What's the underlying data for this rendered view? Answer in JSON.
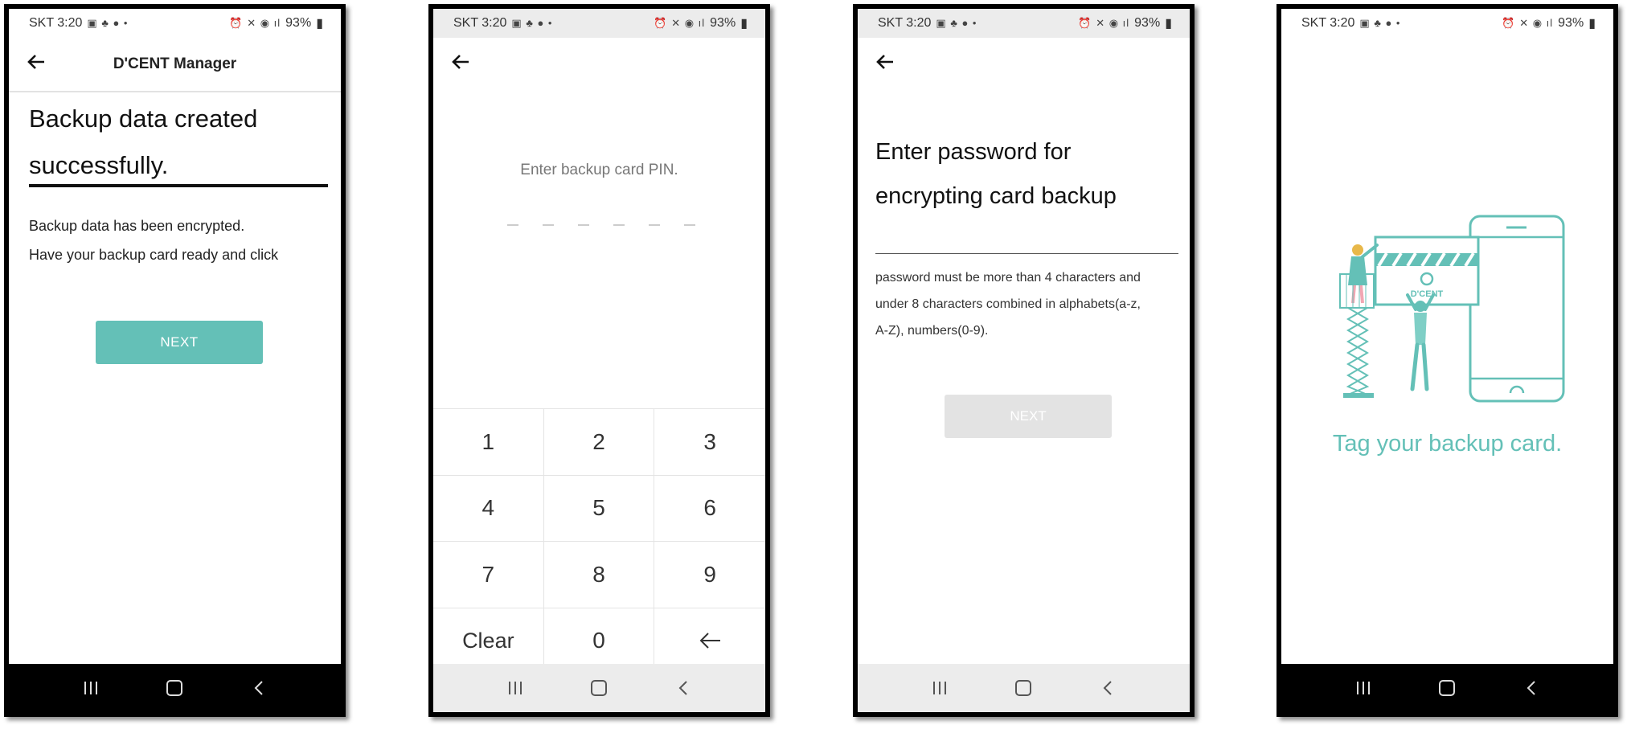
{
  "status_bar": {
    "carrier_time": "SKT 3:20",
    "battery": "93%"
  },
  "screen1": {
    "header_title": "D'CENT Manager",
    "heading_line1": "Backup data created",
    "heading_line2": "successfully.",
    "body_line1": "Backup data has been encrypted.",
    "body_line2": "Have your backup card ready and click",
    "next_label": "NEXT"
  },
  "screen2": {
    "prompt": "Enter backup card PIN.",
    "pin_length": 6,
    "keys": [
      "1",
      "2",
      "3",
      "4",
      "5",
      "6",
      "7",
      "8",
      "9",
      "Clear",
      "0"
    ]
  },
  "screen3": {
    "heading_line1": "Enter password for",
    "heading_line2": "encrypting card backup",
    "password_value": "",
    "help_line1": "password must be more than 4 characters and",
    "help_line2": "under 8 characters combined in alphabets(a-z,",
    "help_line3": "A-Z), numbers(0-9).",
    "next_label": "NEXT"
  },
  "screen4": {
    "card_brand": "D'CENT",
    "title": "Tag your backup card."
  },
  "colors": {
    "accent": "#64c0b7",
    "disabled": "#e3e3e3"
  },
  "icons": {
    "back": "arrow-left-icon",
    "backspace": "backspace-arrow-icon",
    "nav_recent": "recent-apps-icon",
    "nav_home": "home-icon",
    "nav_back": "chevron-left-icon"
  }
}
